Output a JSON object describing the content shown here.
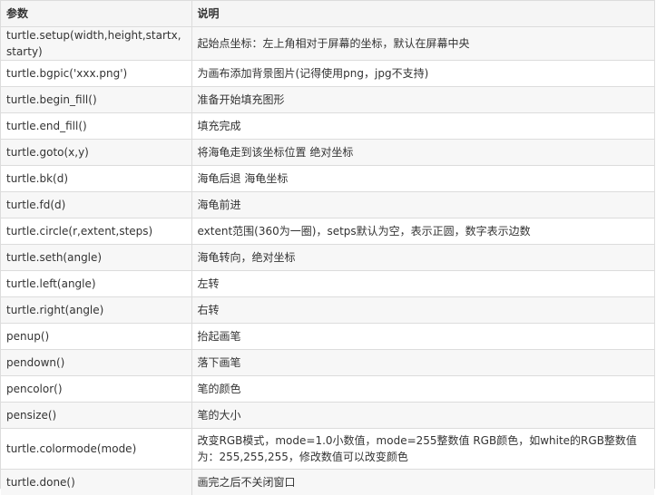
{
  "header": {
    "param": "参数",
    "desc": "说明"
  },
  "rows": [
    {
      "param": "turtle.setup(width,height,startx,starty)",
      "desc": "起始点坐标：左上角相对于屏幕的坐标，默认在屏幕中央"
    },
    {
      "param": "turtle.bgpic('xxx.png')",
      "desc": "为画布添加背景图片(记得使用png，jpg不支持)"
    },
    {
      "param": "turtle.begin_fill()",
      "desc": "准备开始填充图形"
    },
    {
      "param": "turtle.end_fill()",
      "desc": "填充完成"
    },
    {
      "param": "turtle.goto(x,y)",
      "desc": "将海龟走到该坐标位置 绝对坐标"
    },
    {
      "param": "turtle.bk(d)",
      "desc": "海龟后退 海龟坐标"
    },
    {
      "param": "turtle.fd(d)",
      "desc": "海龟前进"
    },
    {
      "param": "turtle.circle(r,extent,steps)",
      "desc": "extent范围(360为一圈)，setps默认为空，表示正圆，数字表示边数"
    },
    {
      "param": "turtle.seth(angle)",
      "desc": "海龟转向，绝对坐标"
    },
    {
      "param": "turtle.left(angle)",
      "desc": "左转"
    },
    {
      "param": "turtle.right(angle)",
      "desc": "右转"
    },
    {
      "param": "penup()",
      "desc": "抬起画笔"
    },
    {
      "param": "pendown()",
      "desc": "落下画笔"
    },
    {
      "param": "pencolor()",
      "desc": "笔的颜色"
    },
    {
      "param": "pensize()",
      "desc": "笔的大小"
    },
    {
      "param": "turtle.colormode(mode)",
      "desc": "改变RGB模式，mode=1.0小数值，mode=255整数值 RGB颜色，如white的RGB整数值为：255,255,255，修改数值可以改变颜色"
    },
    {
      "param": "turtle.done()",
      "desc": "画完之后不关闭窗口"
    }
  ]
}
